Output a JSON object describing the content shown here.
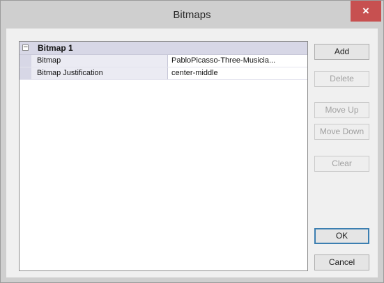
{
  "window": {
    "title": "Bitmaps",
    "close_glyph": "×"
  },
  "grid": {
    "toggle_glyph": "−",
    "group_label": "Bitmap 1",
    "rows": [
      {
        "name": "Bitmap",
        "value": "PabloPicasso-Three-Musicia..."
      },
      {
        "name": "Bitmap Justification",
        "value": "center-middle"
      }
    ]
  },
  "buttons": {
    "add": "Add",
    "delete": "Delete",
    "move_up": "Move Up",
    "move_down": "Move Down",
    "clear": "Clear",
    "ok": "OK",
    "cancel": "Cancel"
  },
  "colors": {
    "close_button": "#c75050",
    "titlebar": "#cfcfcf",
    "group_header": "#d7d7e6"
  }
}
